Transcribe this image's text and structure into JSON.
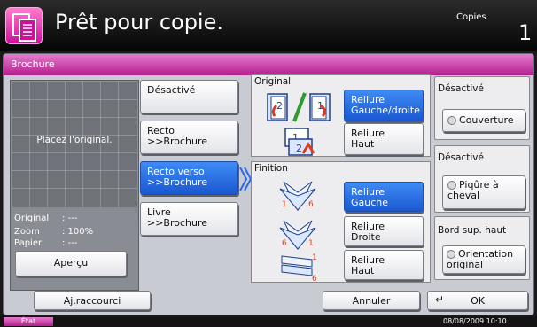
{
  "header": {
    "title": "Prêt pour copie.",
    "copies_label": "Copies",
    "copies_count": "1"
  },
  "panel": {
    "title": "Brochure"
  },
  "preview": {
    "message": "Placez l'original.",
    "original_label": "Original",
    "original_value": ":  ---",
    "zoom_label": "Zoom",
    "zoom_value": ":  100%",
    "paper_label": "Papier",
    "paper_value": ":  ---",
    "apercu_label": "Aperçu"
  },
  "modes": [
    {
      "label": "Désactivé"
    },
    {
      "label": "Recto\n>>Brochure"
    },
    {
      "label": "Recto verso\n>>Brochure",
      "selected": true
    },
    {
      "label": "Livre\n>>Brochure"
    }
  ],
  "original": {
    "label": "Original",
    "opt1": "Reliure\nGauche/droite",
    "opt2": "Reliure\nHaut"
  },
  "finition": {
    "label": "Finition",
    "opt1": "Reliure\nGauche",
    "opt2": "Reliure\nDroite",
    "opt3": "Reliure\nHaut"
  },
  "cover": {
    "value": "Désactivé",
    "button": "Couverture"
  },
  "staple": {
    "value": "Désactivé",
    "button": "Piqûre à\ncheval"
  },
  "orientation": {
    "value": "Bord sup. haut",
    "button": "Orientation\noriginal"
  },
  "bottom": {
    "shortcut": "Aj.raccourci",
    "cancel": "Annuler",
    "ok": "OK"
  },
  "footer": {
    "status": "État",
    "datetime": "08/08/2009   10:10"
  },
  "colors": {
    "accent": "#c0268f",
    "selected": "#1f5fd9"
  }
}
